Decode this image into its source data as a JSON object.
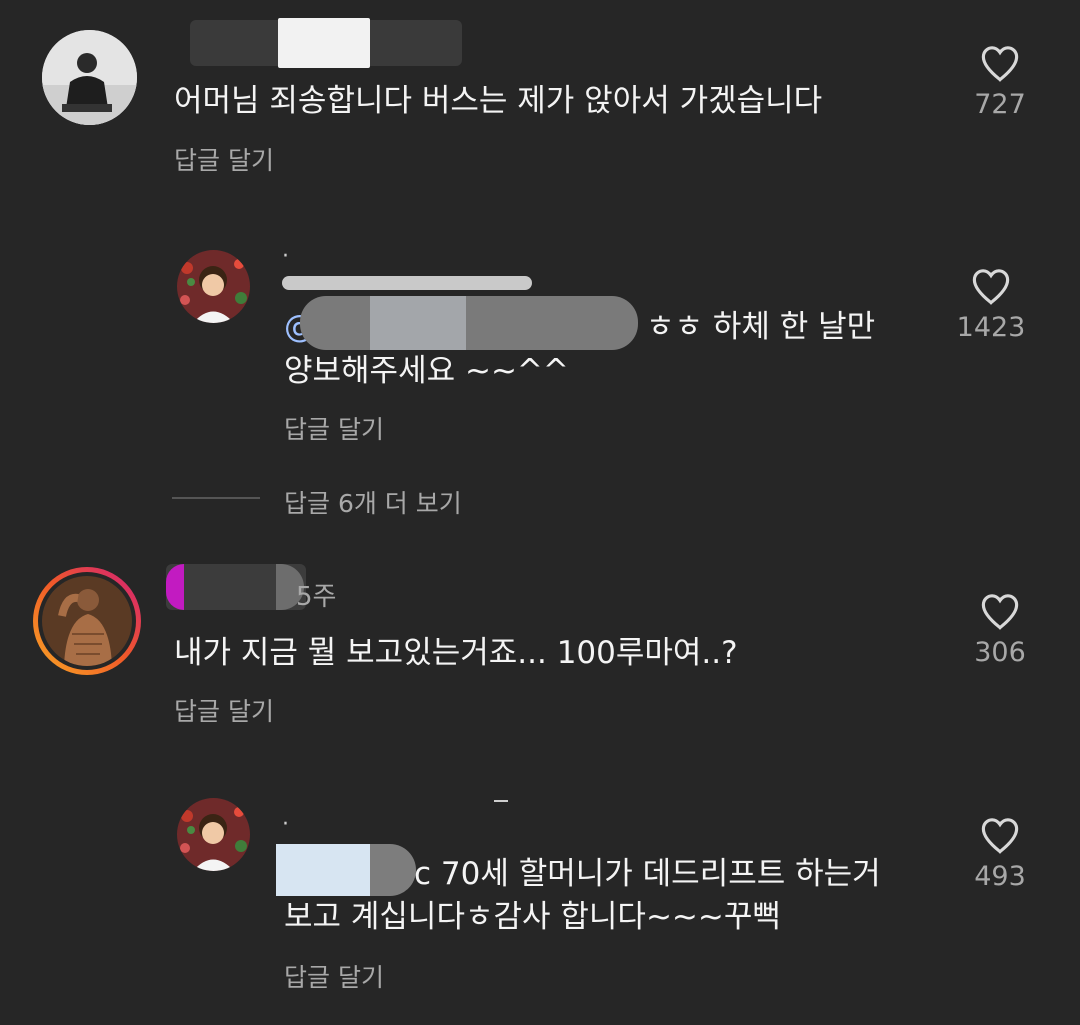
{
  "comments": [
    {
      "text": "어머님 죄송합니다 버스는 제가 앉아서 가겠습니다",
      "reply_label": "답글 달기",
      "likes": "727"
    },
    {
      "text_line1_tail": "ㅎㅎ 하체 한 날만",
      "text_line2": "양보해주세요 ~~^^",
      "reply_label": "답글 달기",
      "likes": "1423"
    },
    {
      "more_replies": "답글 6개 더 보기"
    },
    {
      "time": "5주",
      "text": "내가 지금 뭘 보고있는거죠... 100루마여..?",
      "reply_label": "답글 달기",
      "likes": "306"
    },
    {
      "text_line1_tail": "c 70세 할머니가 데드리프트 하는거",
      "text_line2": "보고 계십니다ㅎ감사 합니다~~~꾸뻑",
      "reply_label": "답글 달기",
      "likes": "493"
    }
  ],
  "mention_prefix": "@",
  "icons": {
    "like": "heart-outline-icon"
  },
  "colors": {
    "background": "#262626",
    "text": "#f4f4f4",
    "muted": "#a8a8a8"
  }
}
